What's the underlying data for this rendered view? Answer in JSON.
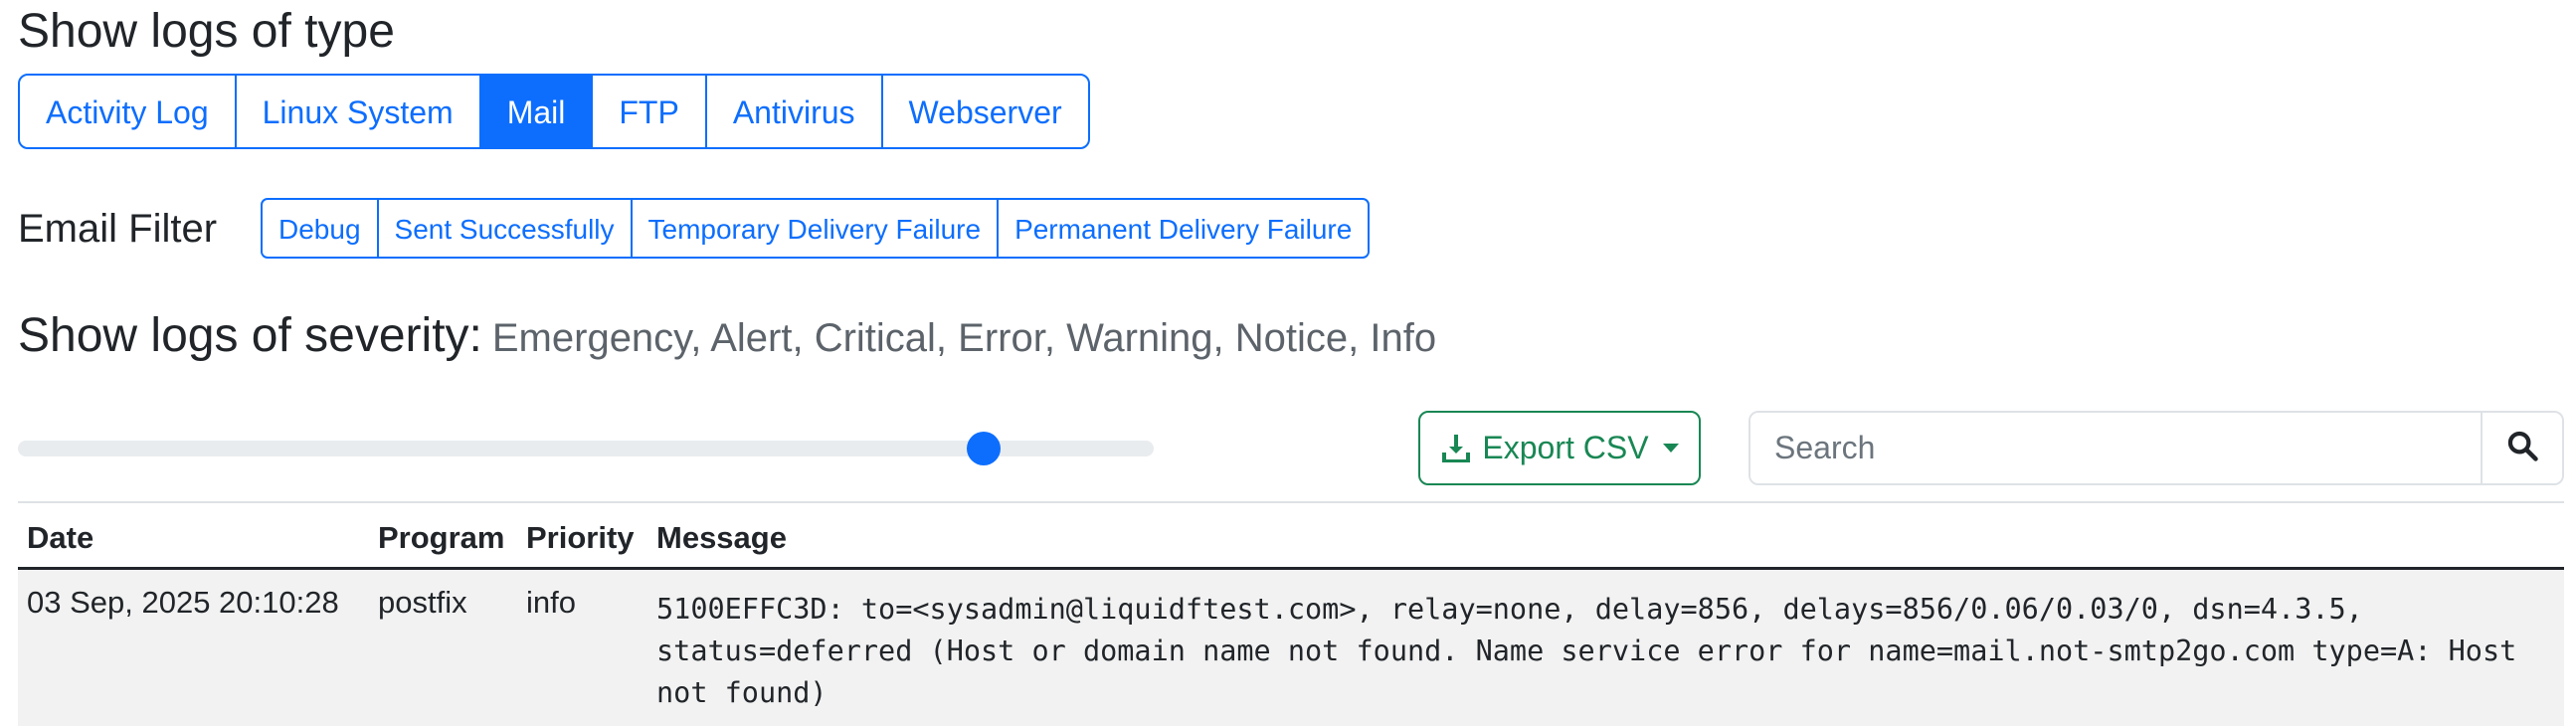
{
  "header": {
    "title": "Show logs of type"
  },
  "log_types": [
    {
      "label": "Activity Log",
      "active": false
    },
    {
      "label": "Linux System",
      "active": false
    },
    {
      "label": "Mail",
      "active": true
    },
    {
      "label": "FTP",
      "active": false
    },
    {
      "label": "Antivirus",
      "active": false
    },
    {
      "label": "Webserver",
      "active": false
    }
  ],
  "email_filter": {
    "label": "Email Filter",
    "options": [
      {
        "label": "Debug",
        "active": false
      },
      {
        "label": "Sent Successfully",
        "active": false
      },
      {
        "label": "Temporary Delivery Failure",
        "active": true
      },
      {
        "label": "Permanent Delivery Failure",
        "active": true
      }
    ]
  },
  "severity": {
    "label": "Show logs of severity:",
    "values": "Emergency, Alert, Critical, Error, Warning, Notice, Info",
    "slider_fraction": 0.85
  },
  "toolbar": {
    "export_label": "Export CSV",
    "search_placeholder": "Search",
    "search_value": ""
  },
  "table": {
    "columns": [
      "Date",
      "Program",
      "Priority",
      "Message"
    ],
    "rows": [
      {
        "date": "03 Sep, 2025 20:10:28",
        "program": "postfix",
        "priority": "info",
        "message": "5100EFFC3D: to=<sysadmin@liquidftest.com>, relay=none, delay=856, delays=856/0.06/0.03/0, dsn=4.3.5, status=deferred (Host or domain name not found. Name service error for name=mail.not-smtp2go.com type=A: Host not found)"
      }
    ]
  },
  "colors": {
    "primary": "#0d6efd",
    "success": "#198754",
    "row_bg": "#f2f2f2"
  },
  "icons": {
    "export": "download-icon",
    "search": "search-icon",
    "caret": "caret-down-icon"
  }
}
